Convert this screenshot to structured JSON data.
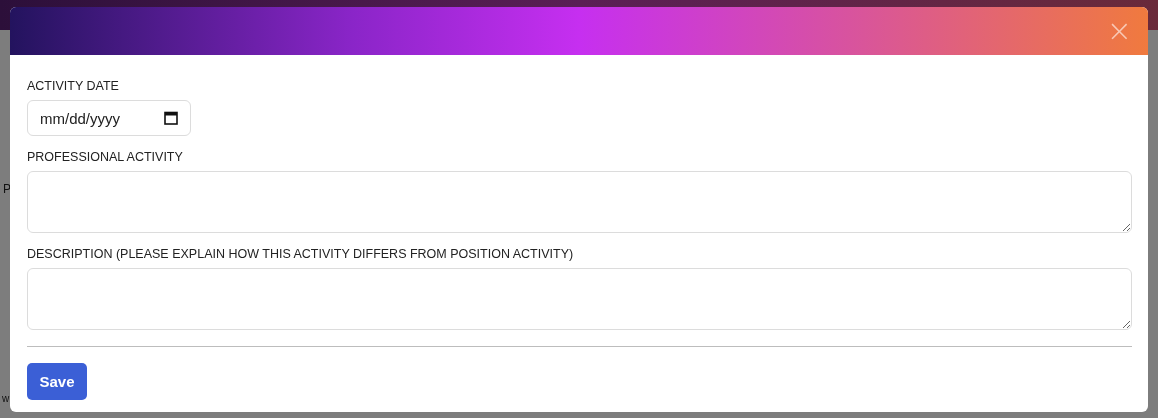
{
  "background": {
    "fragments": [
      "P",
      "w"
    ]
  },
  "modal": {
    "close": "×",
    "fields": [
      {
        "kind": "date",
        "label": "ACTIVITY DATE",
        "placeholder": "mm/dd/yyyy"
      },
      {
        "kind": "textarea",
        "label": "PROFESSIONAL ACTIVITY"
      },
      {
        "kind": "textarea",
        "label": "DESCRIPTION (PLEASE EXPLAIN HOW THIS ACTIVITY DIFFERS FROM POSITION ACTIVITY)"
      }
    ],
    "button": "Save"
  }
}
